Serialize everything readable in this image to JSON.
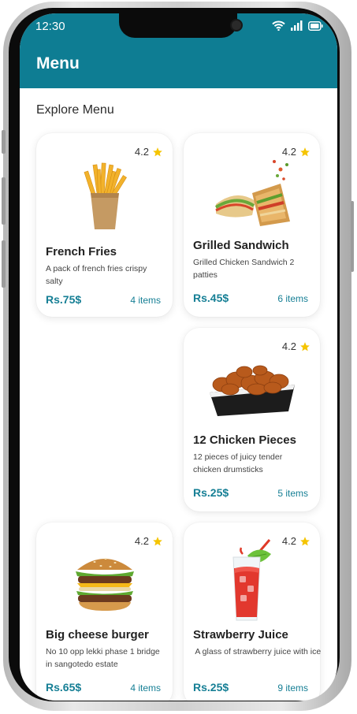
{
  "status_bar": {
    "time": "12:30"
  },
  "app_bar": {
    "title": "Menu"
  },
  "section_title": "Explore Menu",
  "theme": {
    "accent": "#0e7d93",
    "star": "#f5c400"
  },
  "cards": [
    {
      "name": "French Fries",
      "description": "A pack of french fries crispy salty",
      "price": "Rs.75$",
      "items": "4 items",
      "rating": "4.2",
      "image_icon": "french-fries-icon"
    },
    {
      "name": "Grilled Sandwich",
      "description": "Grilled Chicken Sandwich 2 patties",
      "price": "Rs.45$",
      "items": "6 items",
      "rating": "4.2",
      "image_icon": "sandwich-icon"
    },
    {
      "name": "12 Chicken Pieces",
      "description": "12 pieces of juicy tender chicken drumsticks",
      "price": "Rs.25$",
      "items": "5 items",
      "rating": "4.2",
      "image_icon": "fried-chicken-icon"
    },
    {
      "name": "Big cheese burger",
      "description": "No 10 opp lekki phase 1 bridge in sangotedo estate",
      "price": "Rs.65$",
      "items": "4 items",
      "rating": "4.2",
      "image_icon": "burger-icon"
    },
    {
      "name": "Strawberry Juice",
      "description": " A glass of strawberry juice with ice",
      "price": "Rs.25$",
      "items": "9 items",
      "rating": "4.2",
      "image_icon": "juice-glass-icon"
    }
  ]
}
